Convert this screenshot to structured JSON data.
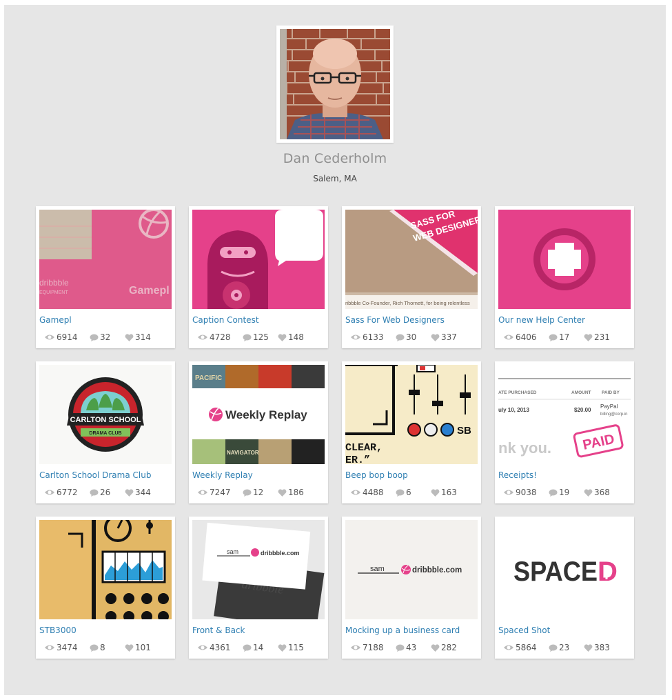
{
  "profile": {
    "name": "Dan Cederholm",
    "location": "Salem, MA"
  },
  "colors": {
    "background": "#e6e6e6",
    "link": "#2f7fb2",
    "dribbble_pink": "#ea4c89"
  },
  "shots": [
    {
      "title": "Gamepl",
      "views": "6914",
      "comments": "32",
      "likes": "314",
      "art": "gamepl",
      "texts": [
        "dribbble",
        "EQUIPMENT",
        "Gamepl"
      ]
    },
    {
      "title": "Caption Contest",
      "views": "4728",
      "comments": "125",
      "likes": "148",
      "art": "caption",
      "texts": []
    },
    {
      "title": "Sass For Web Designers",
      "views": "6133",
      "comments": "30",
      "likes": "337",
      "art": "sass",
      "texts": [
        "SASS FOR",
        "WEB DESIGNERS",
        "ribbble Co-Founder, Rich Thornett, for being relentless"
      ]
    },
    {
      "title": "Our new Help Center",
      "views": "6406",
      "comments": "17",
      "likes": "231",
      "art": "help",
      "texts": []
    },
    {
      "title": "Carlton School Drama Club",
      "views": "6772",
      "comments": "26",
      "likes": "344",
      "art": "carlton",
      "texts": [
        "CARLTON SCHOOL",
        "DRAMA CLUB"
      ]
    },
    {
      "title": "Weekly Replay",
      "views": "7247",
      "comments": "12",
      "likes": "186",
      "art": "weekly",
      "texts": [
        "Weekly Replay",
        "PACIFIC",
        "NAVIGATOR"
      ]
    },
    {
      "title": "Beep bop boop",
      "views": "4488",
      "comments": "6",
      "likes": "163",
      "art": "beep",
      "texts": [
        "CLEAR,",
        "ER.”",
        "SB"
      ]
    },
    {
      "title": "Receipts!",
      "views": "9038",
      "comments": "19",
      "likes": "368",
      "art": "receipts",
      "texts": [
        "ATE PURCHASED",
        "AMOUNT",
        "PAID BY",
        "uly 10, 2013",
        "$20.00",
        "PayPal",
        "billing@corp.in",
        "nk you.",
        "PAID"
      ]
    },
    {
      "title": "STB3000",
      "views": "3474",
      "comments": "8",
      "likes": "101",
      "art": "stb",
      "texts": []
    },
    {
      "title": "Front & Back",
      "views": "4361",
      "comments": "14",
      "likes": "115",
      "art": "frontback",
      "texts": [
        "sam",
        "dribbble.com",
        "dribbble"
      ]
    },
    {
      "title": "Mocking up a business card",
      "views": "7188",
      "comments": "43",
      "likes": "282",
      "art": "mockcard",
      "texts": [
        "sam",
        "dribbble.com"
      ]
    },
    {
      "title": "Spaced Shot",
      "views": "5864",
      "comments": "23",
      "likes": "383",
      "art": "spaced",
      "texts": [
        "SPACE",
        "D"
      ]
    }
  ]
}
